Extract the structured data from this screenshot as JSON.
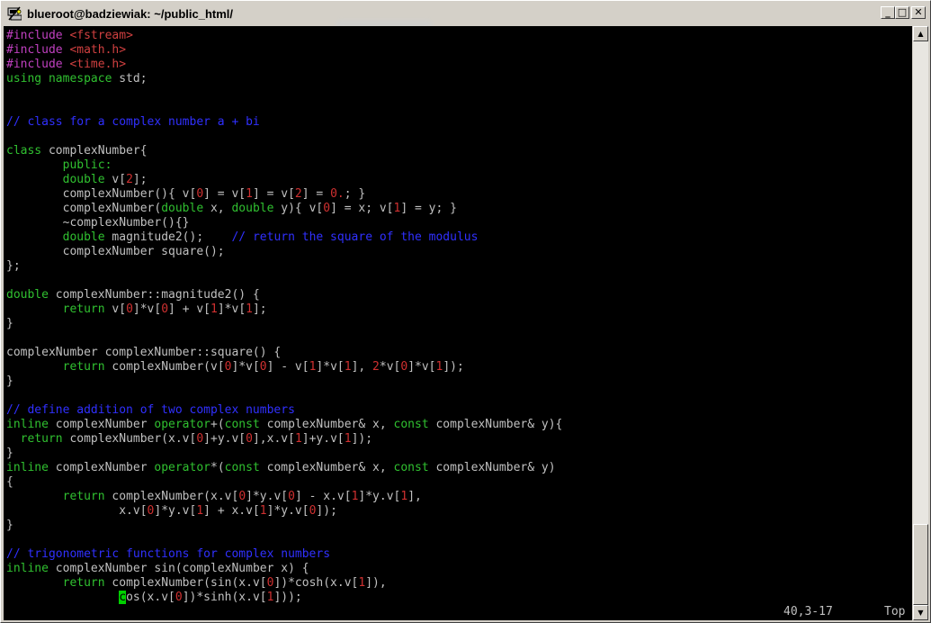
{
  "window": {
    "title": "blueroot@badziewiak: ~/public_html/",
    "buttons": {
      "minimize_glyph": "_",
      "maximize_glyph": "□",
      "close_glyph": "✕"
    }
  },
  "colors": {
    "preprocessor": "#c040c0",
    "include_path": "#d04040",
    "keyword": "#30c030",
    "comment": "#3030ff",
    "number": "#d03030",
    "text": "#c0c0c0",
    "cursor": "#00d000",
    "background": "#000000"
  },
  "editor": {
    "lines": [
      [
        {
          "t": "#include ",
          "c": "preprocessor"
        },
        {
          "t": "<fstream>",
          "c": "include_path"
        }
      ],
      [
        {
          "t": "#include ",
          "c": "preprocessor"
        },
        {
          "t": "<math.h>",
          "c": "include_path"
        }
      ],
      [
        {
          "t": "#include ",
          "c": "preprocessor"
        },
        {
          "t": "<time.h>",
          "c": "include_path"
        }
      ],
      [
        {
          "t": "using namespace",
          "c": "keyword"
        },
        {
          "t": " std;",
          "c": "text"
        }
      ],
      [],
      [],
      [
        {
          "t": "// class for a complex number a + bi",
          "c": "comment"
        }
      ],
      [],
      [
        {
          "t": "class",
          "c": "keyword"
        },
        {
          "t": " complexNumber{",
          "c": "text"
        }
      ],
      [
        {
          "t": "        public:",
          "c": "keyword"
        }
      ],
      [
        {
          "t": "        ",
          "c": "text"
        },
        {
          "t": "double",
          "c": "keyword"
        },
        {
          "t": " v[",
          "c": "text"
        },
        {
          "t": "2",
          "c": "number"
        },
        {
          "t": "];",
          "c": "text"
        }
      ],
      [
        {
          "t": "        complexNumber(){ v[",
          "c": "text"
        },
        {
          "t": "0",
          "c": "number"
        },
        {
          "t": "] = v[",
          "c": "text"
        },
        {
          "t": "1",
          "c": "number"
        },
        {
          "t": "] = v[",
          "c": "text"
        },
        {
          "t": "2",
          "c": "number"
        },
        {
          "t": "] = ",
          "c": "text"
        },
        {
          "t": "0.",
          "c": "number"
        },
        {
          "t": "; }",
          "c": "text"
        }
      ],
      [
        {
          "t": "        complexNumber(",
          "c": "text"
        },
        {
          "t": "double",
          "c": "keyword"
        },
        {
          "t": " x, ",
          "c": "text"
        },
        {
          "t": "double",
          "c": "keyword"
        },
        {
          "t": " y){ v[",
          "c": "text"
        },
        {
          "t": "0",
          "c": "number"
        },
        {
          "t": "] = x; v[",
          "c": "text"
        },
        {
          "t": "1",
          "c": "number"
        },
        {
          "t": "] = y; }",
          "c": "text"
        }
      ],
      [
        {
          "t": "        ~complexNumber(){}",
          "c": "text"
        }
      ],
      [
        {
          "t": "        ",
          "c": "text"
        },
        {
          "t": "double",
          "c": "keyword"
        },
        {
          "t": " magnitude2();    ",
          "c": "text"
        },
        {
          "t": "// return the square of the modulus",
          "c": "comment"
        }
      ],
      [
        {
          "t": "        complexNumber square();",
          "c": "text"
        }
      ],
      [
        {
          "t": "};",
          "c": "text"
        }
      ],
      [],
      [
        {
          "t": "double",
          "c": "keyword"
        },
        {
          "t": " complexNumber::magnitude2() {",
          "c": "text"
        }
      ],
      [
        {
          "t": "        ",
          "c": "text"
        },
        {
          "t": "return",
          "c": "keyword"
        },
        {
          "t": " v[",
          "c": "text"
        },
        {
          "t": "0",
          "c": "number"
        },
        {
          "t": "]*v[",
          "c": "text"
        },
        {
          "t": "0",
          "c": "number"
        },
        {
          "t": "] + v[",
          "c": "text"
        },
        {
          "t": "1",
          "c": "number"
        },
        {
          "t": "]*v[",
          "c": "text"
        },
        {
          "t": "1",
          "c": "number"
        },
        {
          "t": "];",
          "c": "text"
        }
      ],
      [
        {
          "t": "}",
          "c": "text"
        }
      ],
      [],
      [
        {
          "t": "complexNumber complexNumber::square() {",
          "c": "text"
        }
      ],
      [
        {
          "t": "        ",
          "c": "text"
        },
        {
          "t": "return",
          "c": "keyword"
        },
        {
          "t": " complexNumber(v[",
          "c": "text"
        },
        {
          "t": "0",
          "c": "number"
        },
        {
          "t": "]*v[",
          "c": "text"
        },
        {
          "t": "0",
          "c": "number"
        },
        {
          "t": "] - v[",
          "c": "text"
        },
        {
          "t": "1",
          "c": "number"
        },
        {
          "t": "]*v[",
          "c": "text"
        },
        {
          "t": "1",
          "c": "number"
        },
        {
          "t": "], ",
          "c": "text"
        },
        {
          "t": "2",
          "c": "number"
        },
        {
          "t": "*v[",
          "c": "text"
        },
        {
          "t": "0",
          "c": "number"
        },
        {
          "t": "]*v[",
          "c": "text"
        },
        {
          "t": "1",
          "c": "number"
        },
        {
          "t": "]);",
          "c": "text"
        }
      ],
      [
        {
          "t": "}",
          "c": "text"
        }
      ],
      [],
      [
        {
          "t": "// define addition of two complex numbers",
          "c": "comment"
        }
      ],
      [
        {
          "t": "inline",
          "c": "keyword"
        },
        {
          "t": " complexNumber ",
          "c": "text"
        },
        {
          "t": "operator",
          "c": "keyword"
        },
        {
          "t": "+(",
          "c": "text"
        },
        {
          "t": "const",
          "c": "keyword"
        },
        {
          "t": " complexNumber& x, ",
          "c": "text"
        },
        {
          "t": "const",
          "c": "keyword"
        },
        {
          "t": " complexNumber& y){",
          "c": "text"
        }
      ],
      [
        {
          "t": "  ",
          "c": "text"
        },
        {
          "t": "return",
          "c": "keyword"
        },
        {
          "t": " complexNumber(x.v[",
          "c": "text"
        },
        {
          "t": "0",
          "c": "number"
        },
        {
          "t": "]+y.v[",
          "c": "text"
        },
        {
          "t": "0",
          "c": "number"
        },
        {
          "t": "],x.v[",
          "c": "text"
        },
        {
          "t": "1",
          "c": "number"
        },
        {
          "t": "]+y.v[",
          "c": "text"
        },
        {
          "t": "1",
          "c": "number"
        },
        {
          "t": "]);",
          "c": "text"
        }
      ],
      [
        {
          "t": "}",
          "c": "text"
        }
      ],
      [
        {
          "t": "inline",
          "c": "keyword"
        },
        {
          "t": " complexNumber ",
          "c": "text"
        },
        {
          "t": "operator",
          "c": "keyword"
        },
        {
          "t": "*(",
          "c": "text"
        },
        {
          "t": "const",
          "c": "keyword"
        },
        {
          "t": " complexNumber& x, ",
          "c": "text"
        },
        {
          "t": "const",
          "c": "keyword"
        },
        {
          "t": " complexNumber& y)",
          "c": "text"
        }
      ],
      [
        {
          "t": "{",
          "c": "text"
        }
      ],
      [
        {
          "t": "        ",
          "c": "text"
        },
        {
          "t": "return",
          "c": "keyword"
        },
        {
          "t": " complexNumber(x.v[",
          "c": "text"
        },
        {
          "t": "0",
          "c": "number"
        },
        {
          "t": "]*y.v[",
          "c": "text"
        },
        {
          "t": "0",
          "c": "number"
        },
        {
          "t": "] - x.v[",
          "c": "text"
        },
        {
          "t": "1",
          "c": "number"
        },
        {
          "t": "]*y.v[",
          "c": "text"
        },
        {
          "t": "1",
          "c": "number"
        },
        {
          "t": "],",
          "c": "text"
        }
      ],
      [
        {
          "t": "                x.v[",
          "c": "text"
        },
        {
          "t": "0",
          "c": "number"
        },
        {
          "t": "]*y.v[",
          "c": "text"
        },
        {
          "t": "1",
          "c": "number"
        },
        {
          "t": "] + x.v[",
          "c": "text"
        },
        {
          "t": "1",
          "c": "number"
        },
        {
          "t": "]*y.v[",
          "c": "text"
        },
        {
          "t": "0",
          "c": "number"
        },
        {
          "t": "]);",
          "c": "text"
        }
      ],
      [
        {
          "t": "}",
          "c": "text"
        }
      ],
      [],
      [
        {
          "t": "// trigonometric functions for complex numbers",
          "c": "comment"
        }
      ],
      [
        {
          "t": "inline",
          "c": "keyword"
        },
        {
          "t": " complexNumber sin(complexNumber x) {",
          "c": "text"
        }
      ],
      [
        {
          "t": "        ",
          "c": "text"
        },
        {
          "t": "return",
          "c": "keyword"
        },
        {
          "t": " complexNumber(sin(x.v[",
          "c": "text"
        },
        {
          "t": "0",
          "c": "number"
        },
        {
          "t": "])*cosh(x.v[",
          "c": "text"
        },
        {
          "t": "1",
          "c": "number"
        },
        {
          "t": "]),",
          "c": "text"
        }
      ],
      [
        {
          "t": "                ",
          "c": "text"
        },
        {
          "t": "c",
          "c": "cursor"
        },
        {
          "t": "os(x.v[",
          "c": "text"
        },
        {
          "t": "0",
          "c": "number"
        },
        {
          "t": "])*sinh(x.v[",
          "c": "text"
        },
        {
          "t": "1",
          "c": "number"
        },
        {
          "t": "]));",
          "c": "text"
        }
      ]
    ]
  },
  "status": {
    "cursor_position": "40,3-17",
    "scroll_position": "Top"
  }
}
